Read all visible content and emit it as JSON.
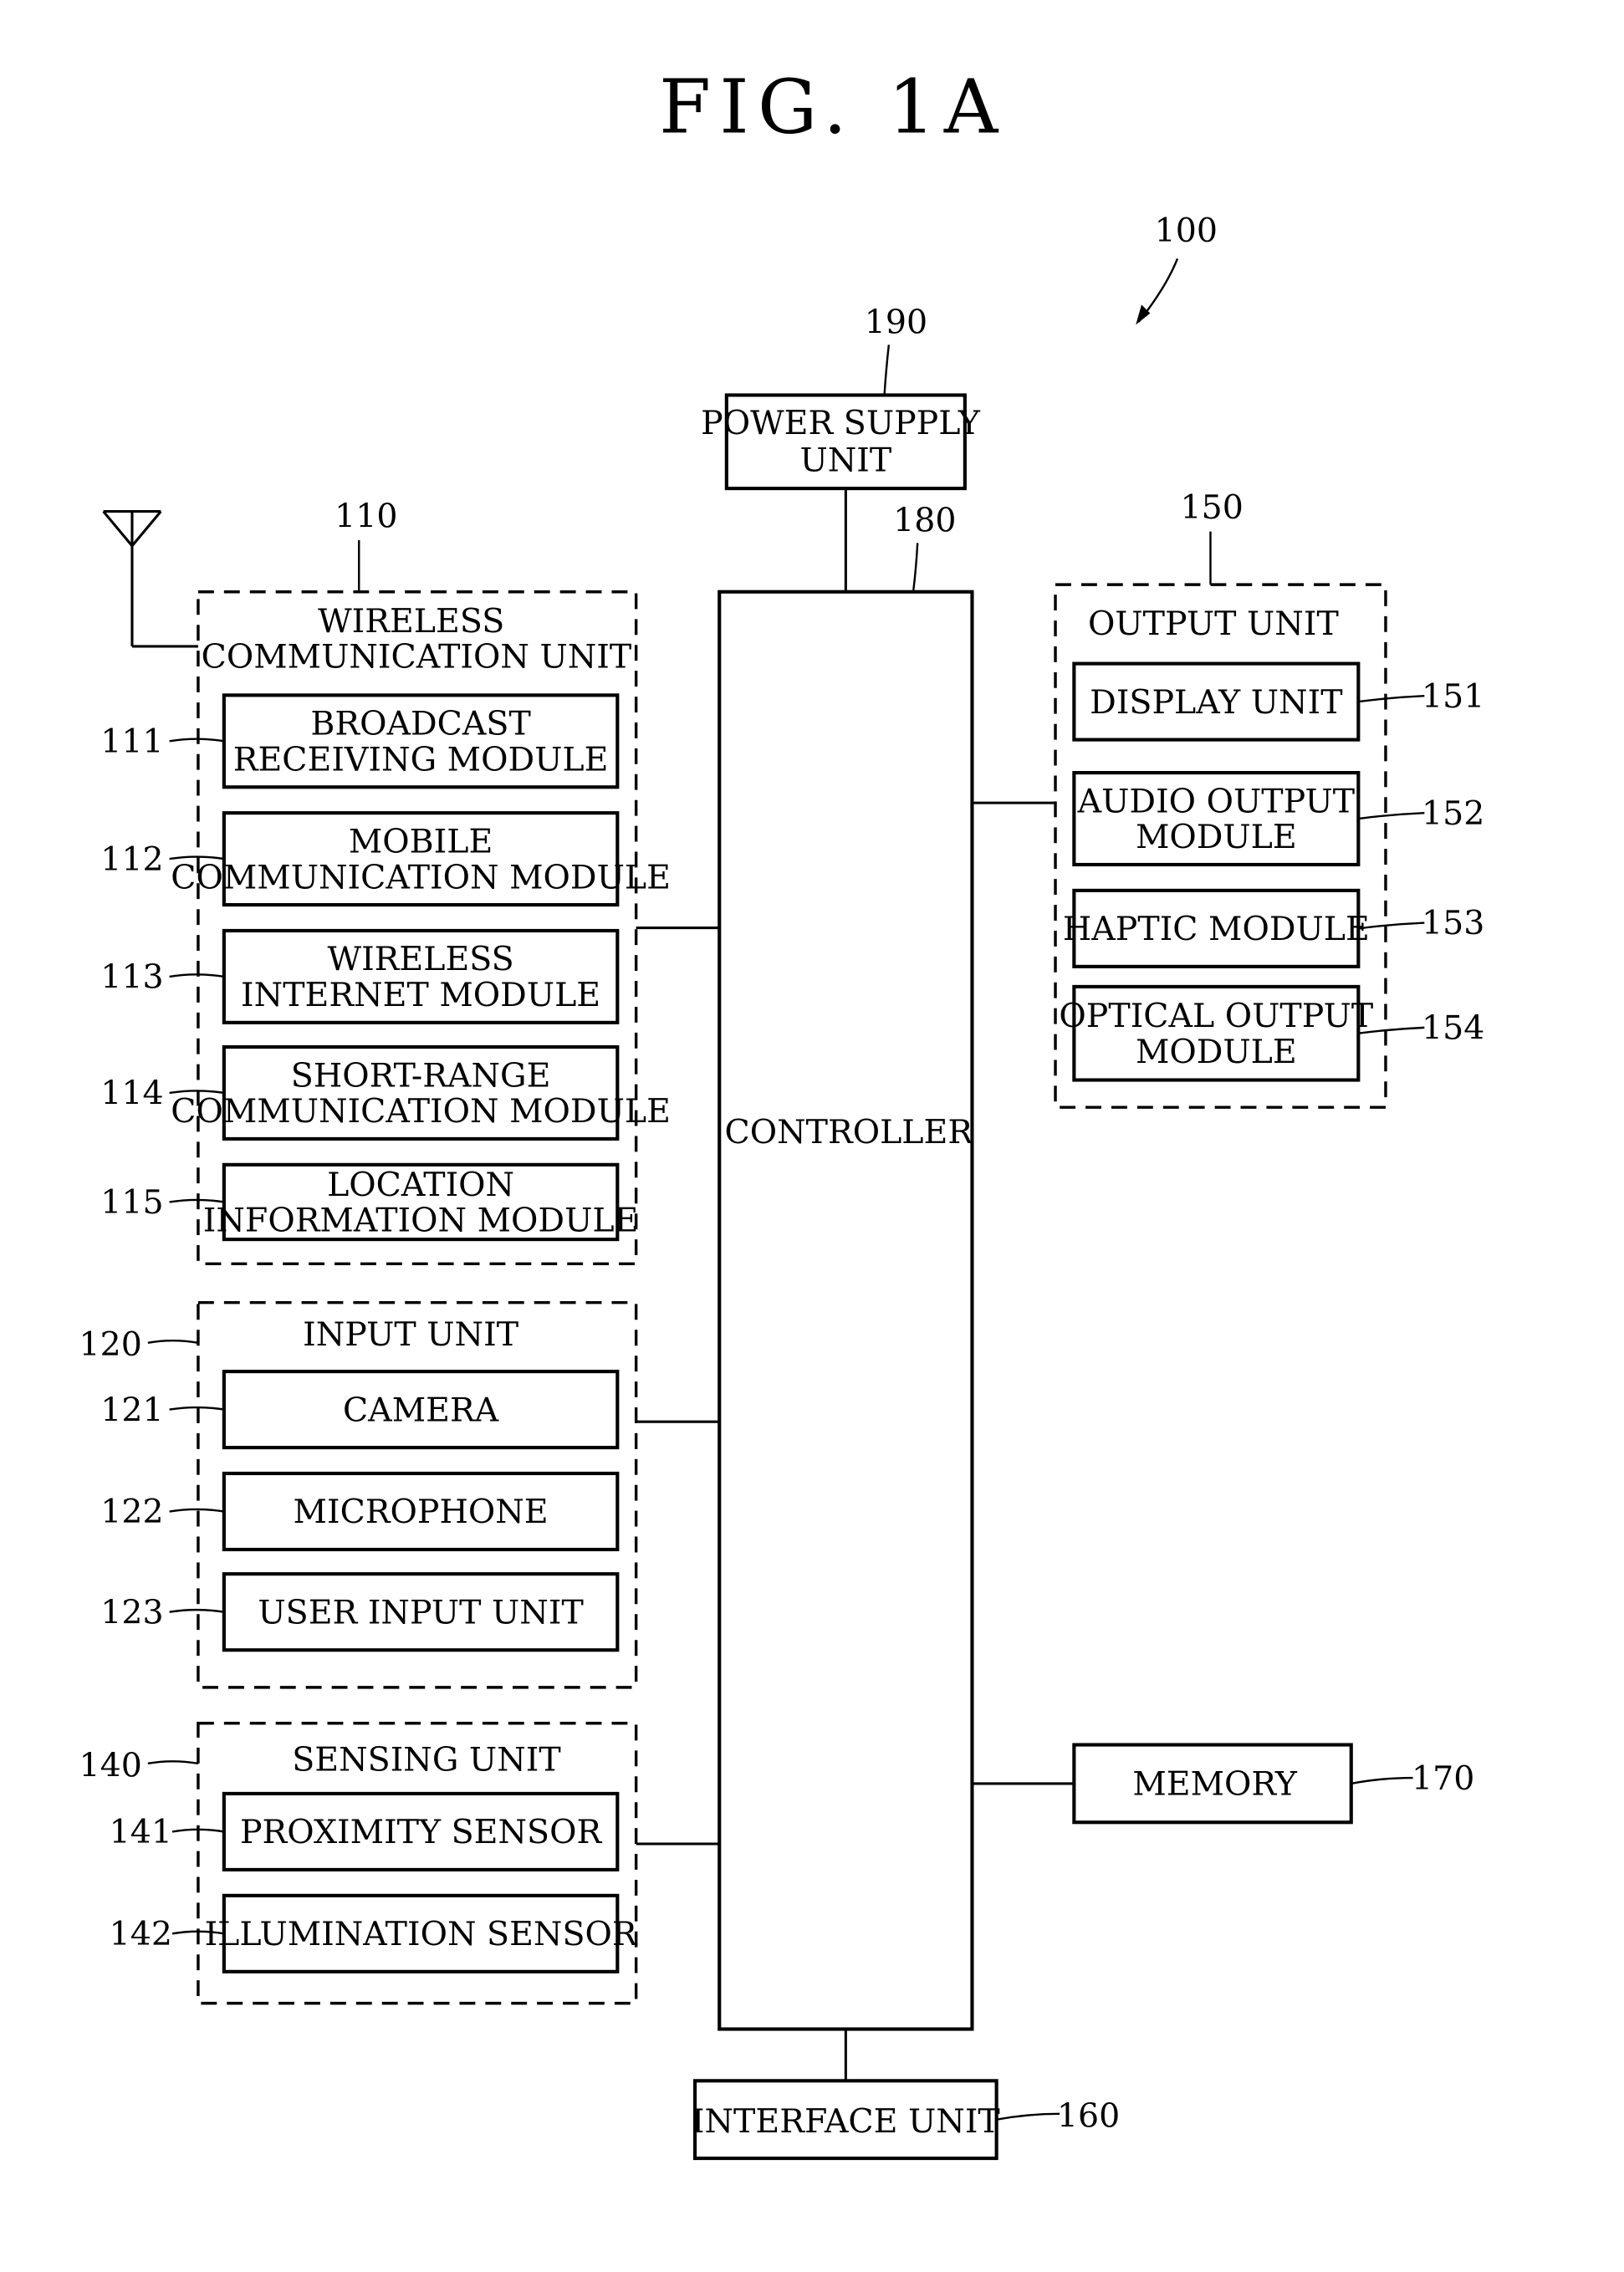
{
  "figure": {
    "title": "FIG. 1A",
    "device_ref": "100"
  },
  "power_supply": {
    "ref": "190",
    "lines": [
      "POWER SUPPLY",
      "UNIT"
    ]
  },
  "controller": {
    "ref": "180",
    "lines": [
      "CONTROLLER"
    ]
  },
  "interface_unit": {
    "ref": "160",
    "lines": [
      "INTERFACE UNIT"
    ]
  },
  "memory": {
    "ref": "170",
    "lines": [
      "MEMORY"
    ]
  },
  "wireless_unit": {
    "ref": "110",
    "lines": [
      "WIRELESS",
      "COMMUNICATION UNIT"
    ],
    "antenna_icon": "antenna-icon",
    "modules": [
      {
        "ref": "111",
        "lines": [
          "BROADCAST",
          "RECEIVING MODULE"
        ]
      },
      {
        "ref": "112",
        "lines": [
          "MOBILE",
          "COMMUNICATION MODULE"
        ]
      },
      {
        "ref": "113",
        "lines": [
          "WIRELESS",
          "INTERNET MODULE"
        ]
      },
      {
        "ref": "114",
        "lines": [
          "SHORT-RANGE",
          "COMMUNICATION MODULE"
        ]
      },
      {
        "ref": "115",
        "lines": [
          "LOCATION",
          "INFORMATION MODULE"
        ]
      }
    ]
  },
  "input_unit": {
    "ref": "120",
    "lines": [
      "INPUT UNIT"
    ],
    "modules": [
      {
        "ref": "121",
        "lines": [
          "CAMERA"
        ]
      },
      {
        "ref": "122",
        "lines": [
          "MICROPHONE"
        ]
      },
      {
        "ref": "123",
        "lines": [
          "USER INPUT UNIT"
        ]
      }
    ]
  },
  "sensing_unit": {
    "ref": "140",
    "lines": [
      "SENSING UNIT"
    ],
    "modules": [
      {
        "ref": "141",
        "lines": [
          "PROXIMITY SENSOR"
        ]
      },
      {
        "ref": "142",
        "lines": [
          "ILLUMINATION SENSOR"
        ]
      }
    ]
  },
  "output_unit": {
    "ref": "150",
    "lines": [
      "OUTPUT UNIT"
    ],
    "modules": [
      {
        "ref": "151",
        "lines": [
          "DISPLAY UNIT"
        ]
      },
      {
        "ref": "152",
        "lines": [
          "AUDIO OUTPUT",
          "MODULE"
        ]
      },
      {
        "ref": "153",
        "lines": [
          "HAPTIC MODULE"
        ]
      },
      {
        "ref": "154",
        "lines": [
          "OPTICAL OUTPUT",
          "MODULE"
        ]
      }
    ]
  }
}
